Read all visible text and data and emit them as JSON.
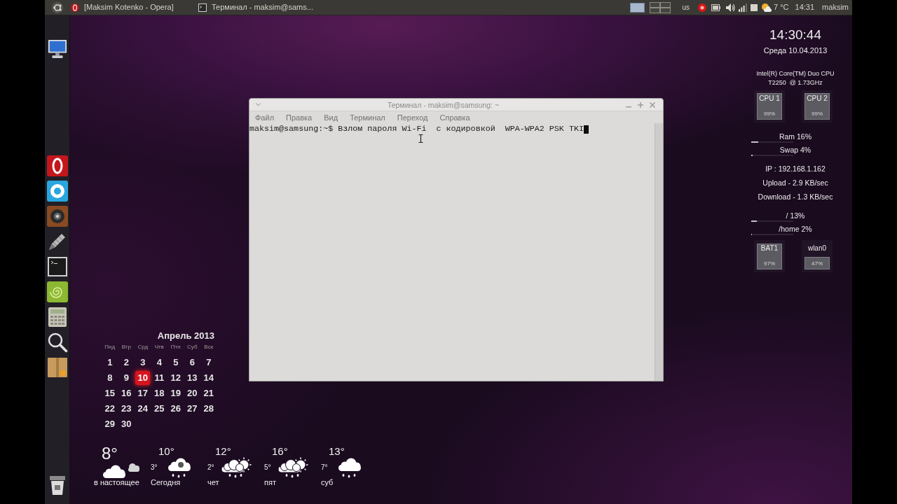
{
  "top_panel": {
    "windows": [
      {
        "title": "[Maksim Kotenko - Opera]",
        "kind": "browser"
      },
      {
        "title": "Терминал - maksim@sams...",
        "kind": "terminal"
      }
    ],
    "keyboard_layout": "us",
    "temperature": "7 °C",
    "clock": "14:31",
    "user": "maksim"
  },
  "terminal": {
    "title": "Терминал - maksim@samsung: ~",
    "menu": [
      "Файл",
      "Правка",
      "Вид",
      "Терминал",
      "Переход",
      "Справка"
    ],
    "lines": [
      "maksim@samsung:~$ Взлом пароля Wi-Fi  с кодировкой  WPA-WPA2 PSK TKI"
    ]
  },
  "system_monitor": {
    "time": "14:30:44",
    "date": "Среда 10.04.2013",
    "cpu_model": [
      "Intel(R) Core(TM) Duo CPU",
      "T2250  @ 1.73GHz"
    ],
    "cpus": [
      {
        "label": "CPU 1",
        "reading": "99%",
        "level": 0.99
      },
      {
        "label": "CPU 2",
        "reading": "99%",
        "level": 0.99
      }
    ],
    "memory": [
      {
        "label": "Ram 16%",
        "level": 0.16
      },
      {
        "label": "Swap 4%",
        "level": 0.04
      }
    ],
    "network": [
      "IP : 192.168.1.162",
      "Upload - 2.9 KB/sec",
      "Download - 1.3 KB/sec"
    ],
    "disks": [
      {
        "label": "/ 13%",
        "level": 0.13
      },
      {
        "label": "/home 2%",
        "level": 0.02
      }
    ],
    "gauges": [
      {
        "label": "BAT1",
        "reading": "97%",
        "level": 0.97
      },
      {
        "label": "wlan0",
        "reading": "47%",
        "level": 0.47
      }
    ]
  },
  "calendar": {
    "title": "Апрель 2013",
    "weekdays": [
      "Пнд",
      "Втр",
      "Срд",
      "Чтв",
      "Птн",
      "Суб",
      "Вск"
    ],
    "days": [
      {
        "day": "1",
        "selected": false
      },
      {
        "day": "2",
        "selected": false
      },
      {
        "day": "3",
        "selected": false
      },
      {
        "day": "4",
        "selected": false
      },
      {
        "day": "5",
        "selected": false
      },
      {
        "day": "6",
        "selected": false
      },
      {
        "day": "7",
        "selected": false
      },
      {
        "day": "8",
        "selected": false
      },
      {
        "day": "9",
        "selected": false
      },
      {
        "day": "10",
        "selected": true
      },
      {
        "day": "11",
        "selected": false
      },
      {
        "day": "12",
        "selected": false
      },
      {
        "day": "13",
        "selected": false
      },
      {
        "day": "14",
        "selected": false
      },
      {
        "day": "15",
        "selected": false
      },
      {
        "day": "16",
        "selected": false
      },
      {
        "day": "17",
        "selected": false
      },
      {
        "day": "18",
        "selected": false
      },
      {
        "day": "19",
        "selected": false
      },
      {
        "day": "20",
        "selected": false
      },
      {
        "day": "21",
        "selected": false
      },
      {
        "day": "22",
        "selected": false
      },
      {
        "day": "23",
        "selected": false
      },
      {
        "day": "24",
        "selected": false
      },
      {
        "day": "25",
        "selected": false
      },
      {
        "day": "26",
        "selected": false
      },
      {
        "day": "27",
        "selected": false
      },
      {
        "day": "28",
        "selected": false
      },
      {
        "day": "29",
        "selected": false
      },
      {
        "day": "30",
        "selected": false
      }
    ]
  },
  "weather": [
    {
      "temp": "8°",
      "label": "в настоящее",
      "kind": "cloud"
    },
    {
      "temp": "10°",
      "low": "3°",
      "label": "Сегодня",
      "kind": "sleet"
    },
    {
      "temp": "12°",
      "low": "2°",
      "label": "чет",
      "kind": "sun-rain"
    },
    {
      "temp": "16°",
      "low": "5°",
      "label": "пят",
      "kind": "sun-rain"
    },
    {
      "temp": "13°",
      "low": "7°",
      "label": "суб",
      "kind": "rain"
    }
  ]
}
